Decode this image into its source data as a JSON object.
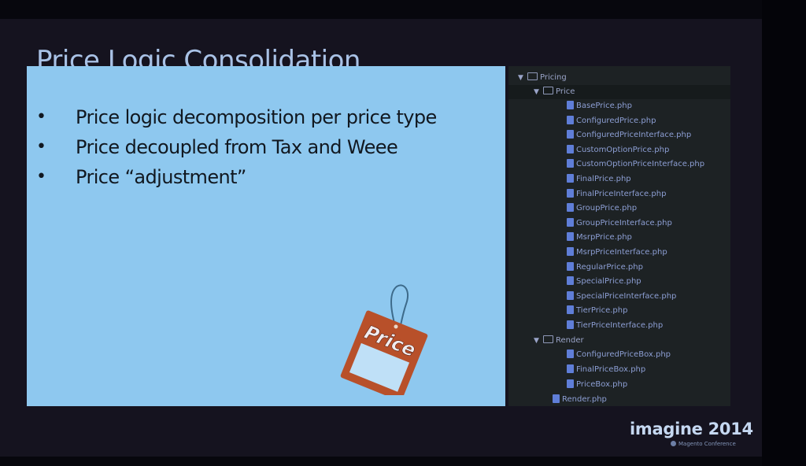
{
  "slide": {
    "title": "Price Logic Consolidation",
    "bullets": [
      {
        "marker": "•",
        "text": "Price logic decomposition per price type"
      },
      {
        "marker": "•",
        "text": "Price decoupled from Tax and Weee"
      },
      {
        "marker": "•",
        "text": "Price “adjustment”"
      }
    ],
    "price_tag_label": "Price"
  },
  "file_tree": {
    "root": {
      "label": "Pricing",
      "icon": "folder-icon",
      "expanded": true
    },
    "price_folder": {
      "label": "Price",
      "icon": "folder-icon",
      "expanded": true,
      "files": [
        "BasePrice.php",
        "ConfiguredPrice.php",
        "ConfiguredPriceInterface.php",
        "CustomOptionPrice.php",
        "CustomOptionPriceInterface.php",
        "FinalPrice.php",
        "FinalPriceInterface.php",
        "GroupPrice.php",
        "GroupPriceInterface.php",
        "MsrpPrice.php",
        "MsrpPriceInterface.php",
        "RegularPrice.php",
        "SpecialPrice.php",
        "SpecialPriceInterface.php",
        "TierPrice.php",
        "TierPriceInterface.php"
      ]
    },
    "render_folder": {
      "label": "Render",
      "icon": "folder-icon",
      "expanded": true,
      "files": [
        "ConfiguredPriceBox.php",
        "FinalPriceBox.php",
        "PriceBox.php"
      ]
    },
    "root_files": [
      "Render.php"
    ]
  },
  "branding": {
    "name": "imagine 2014",
    "subtitle": "Magento Conference"
  },
  "colors": {
    "slide_background": "#15131f",
    "content_panel": "#8ec8ef",
    "title_text": "#a9c2e6",
    "tree_background": "#1d2224",
    "tag_orange": "#b8502a"
  }
}
